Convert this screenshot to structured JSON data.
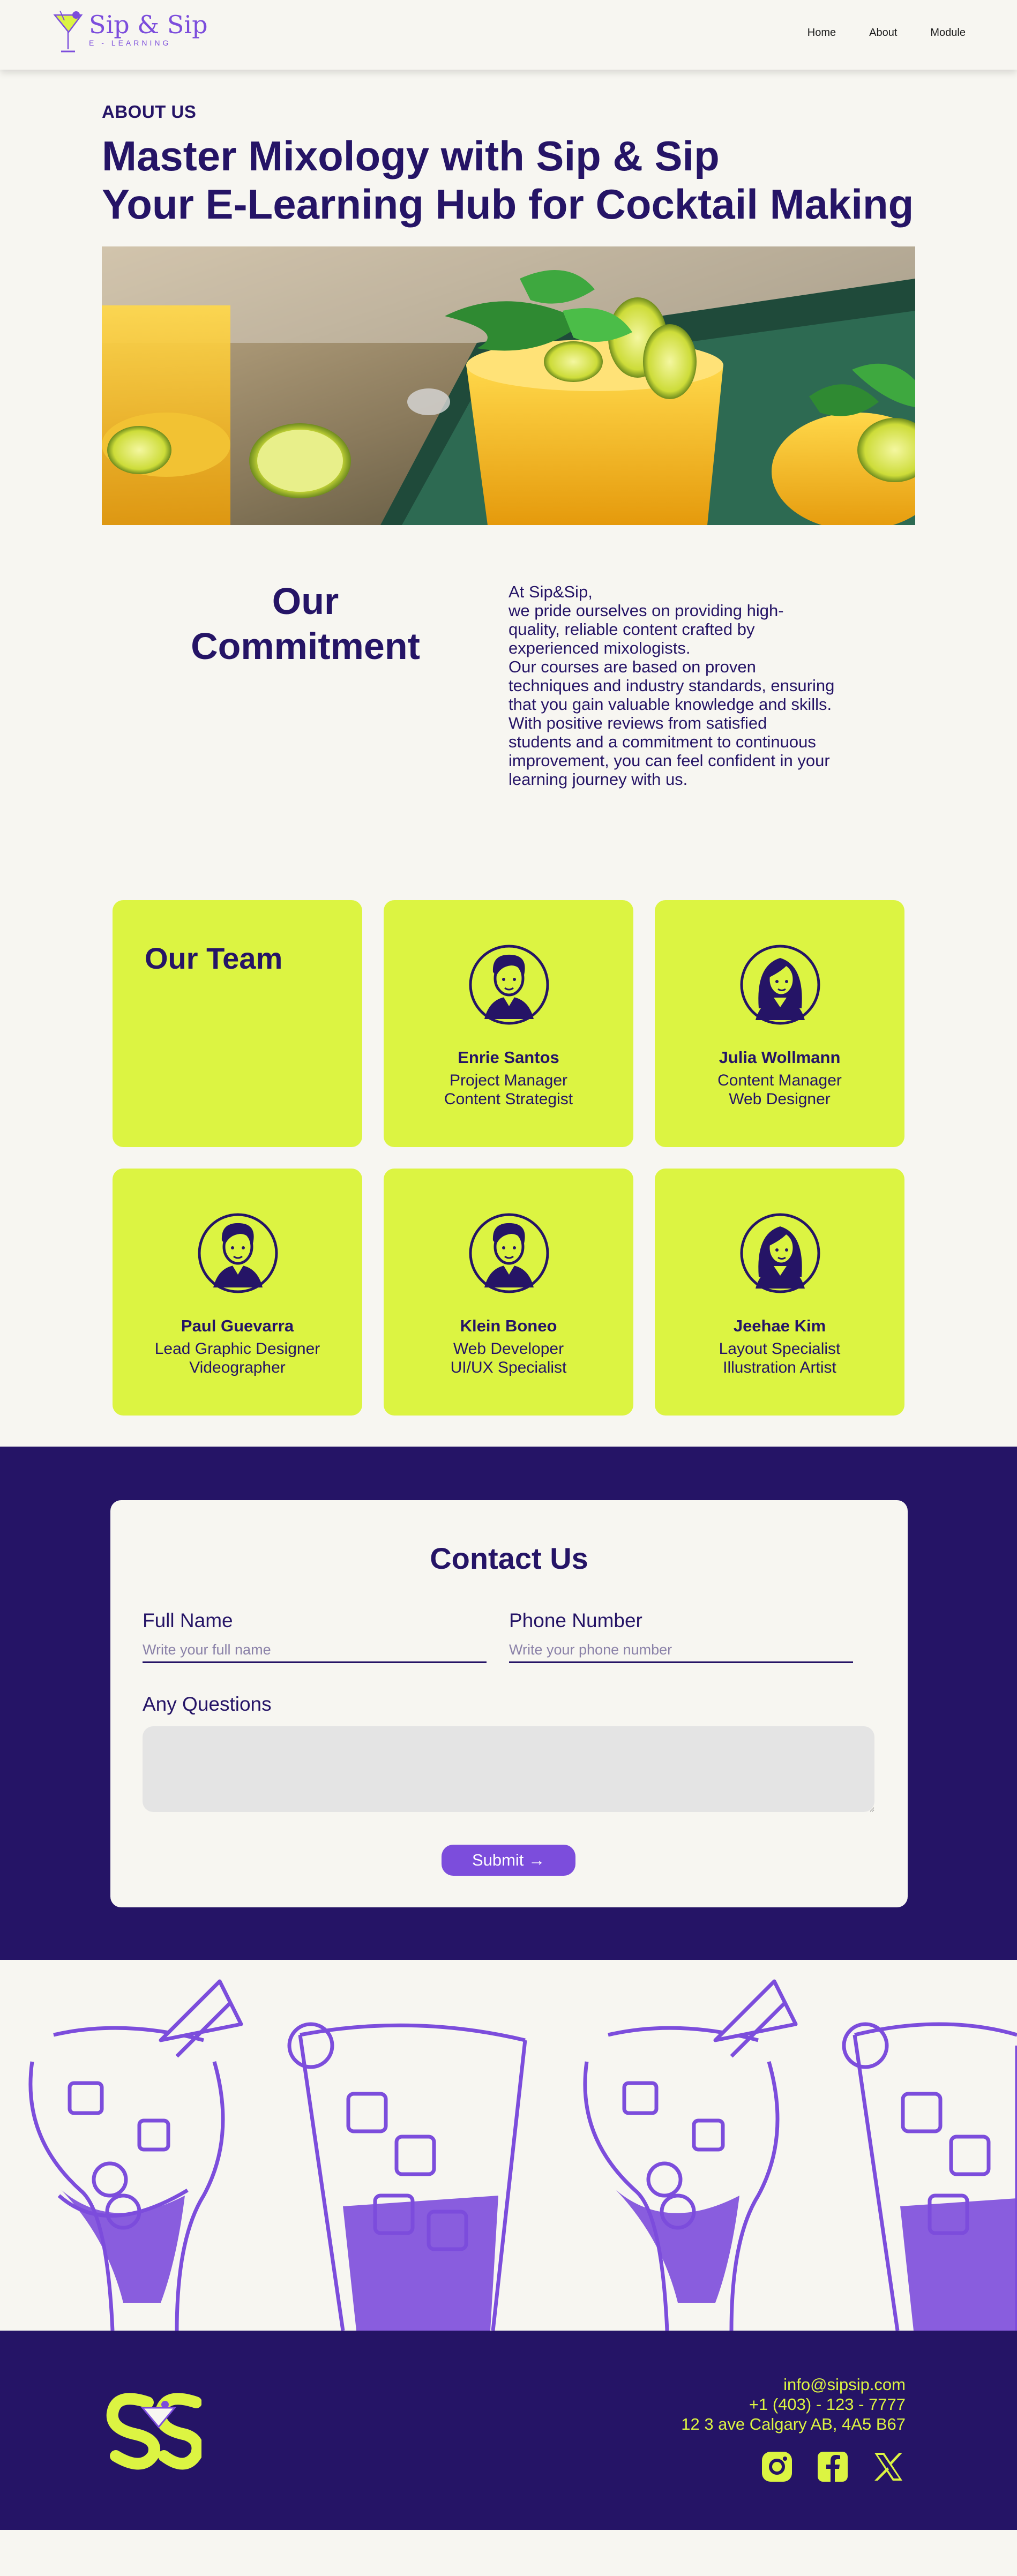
{
  "brand": {
    "name": "Sip & Sip",
    "tagline": "E - LEARNING",
    "colors": {
      "primary": "#251466",
      "accent": "#7c4ddc",
      "lime": "#dcf442",
      "background": "#f7f6f1"
    }
  },
  "nav": {
    "items": [
      "Home",
      "About",
      "Module"
    ]
  },
  "about": {
    "eyebrow": "ABOUT US",
    "title_line1": "Master Mixology with Sip & Sip",
    "title_line2": "Your E-Learning Hub for Cocktail Making"
  },
  "commitment": {
    "title_line1": "Our",
    "title_line2": "Commitment",
    "lines": [
      "At Sip&Sip,",
      "we pride ourselves on providing high-",
      "quality, reliable content crafted by",
      "experienced mixologists.",
      "Our courses are based on proven",
      "techniques and industry standards, ensuring",
      "that you gain valuable knowledge and skills.",
      "With positive reviews from satisfied",
      "students and a commitment to continuous",
      "improvement, you can feel confident in your",
      "learning journey with us."
    ]
  },
  "team": {
    "heading": "Our Team",
    "members": [
      {
        "name": "Enrie Santos",
        "role1": "Project Manager",
        "role2": "Content Strategist",
        "avatar": "male-avatar-icon"
      },
      {
        "name": "Julia Wollmann",
        "role1": "Content Manager",
        "role2": "Web Designer",
        "avatar": "female-avatar-icon"
      },
      {
        "name": "Paul Guevarra",
        "role1": "Lead Graphic Designer",
        "role2": "Videographer",
        "avatar": "male-avatar-icon"
      },
      {
        "name": "Klein Boneo",
        "role1": "Web Developer",
        "role2": "UI/UX Specialist",
        "avatar": "male-avatar-icon"
      },
      {
        "name": "Jeehae Kim",
        "role1": "Layout Specialist",
        "role2": "Illustration Artist",
        "avatar": "female-avatar-icon"
      }
    ]
  },
  "contact": {
    "title": "Contact Us",
    "full_name_label": "Full Name",
    "full_name_placeholder": "Write your full name",
    "phone_label": "Phone Number",
    "phone_placeholder": "Write your phone number",
    "questions_label": "Any Questions",
    "submit_label": "Submit →"
  },
  "footer": {
    "email": "info@sipsip.com",
    "phone": "+1 (403) - 123 - 7777",
    "address": "12 3 ave Calgary AB, 4A5 B67",
    "socials": [
      "instagram-icon",
      "facebook-icon",
      "x-icon"
    ]
  }
}
